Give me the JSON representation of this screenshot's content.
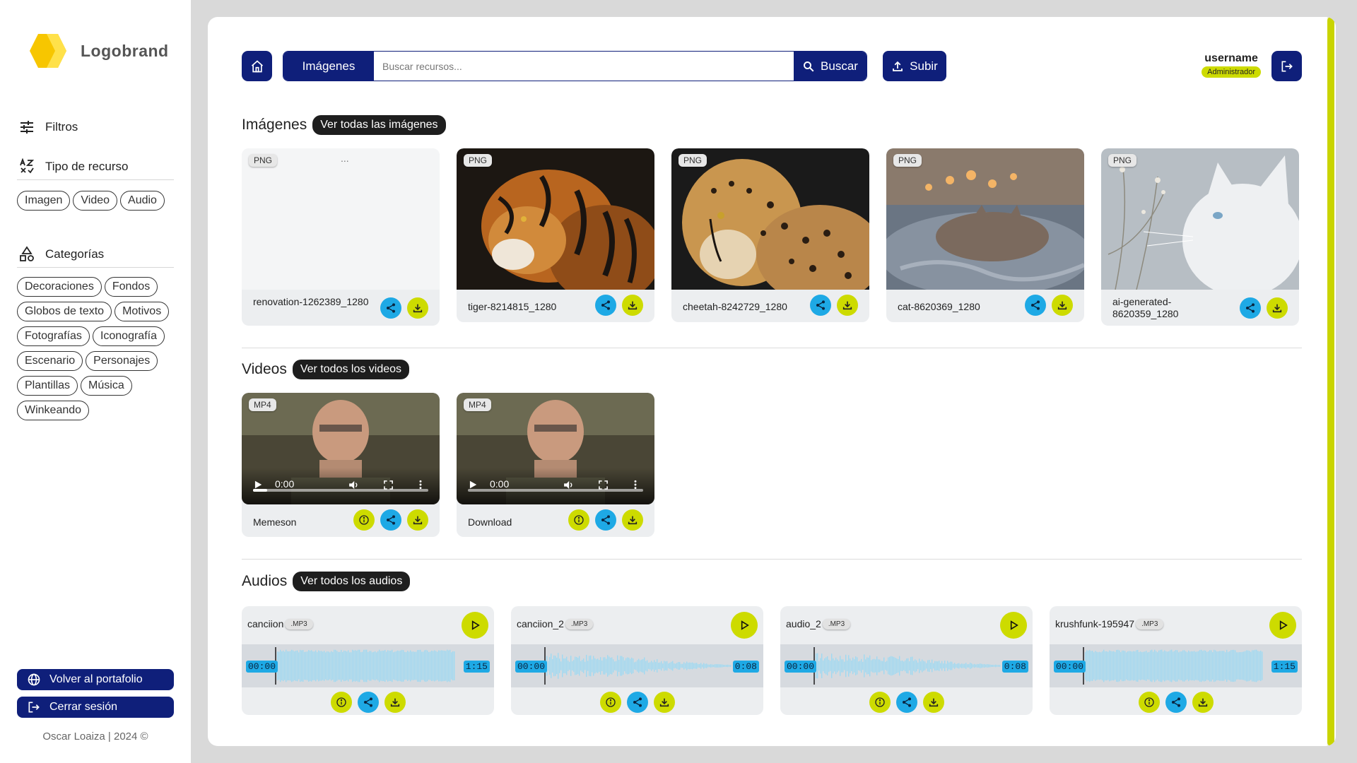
{
  "brand": {
    "name": "Logobrand"
  },
  "sidebar": {
    "filters_label": "Filtros",
    "resource_type": {
      "label": "Tipo de recurso",
      "chips": [
        "Imagen",
        "Video",
        "Audio"
      ]
    },
    "categories": {
      "label": "Categorías",
      "chips": [
        "Decoraciones",
        "Fondos",
        "Globos de texto",
        "Motivos",
        "Fotografías",
        "Iconografía",
        "Escenario",
        "Personajes",
        "Plantillas",
        "Música",
        "Winkeando"
      ]
    },
    "back_button": "Volver al portafolio",
    "logout_button": "Cerrar sesión",
    "footer": "Oscar Loaiza | 2024 ©"
  },
  "topbar": {
    "search_type": "Imágenes",
    "search_placeholder": "Buscar recursos...",
    "search_button": "Buscar",
    "upload_button": "Subir",
    "username": "username",
    "role": "Administrador"
  },
  "images": {
    "title": "Imágenes",
    "see_all": "Ver todas las imágenes",
    "items": [
      {
        "badge": "PNG",
        "name": "renovation-1262389_1280",
        "loading": true
      },
      {
        "badge": "PNG",
        "name": "tiger-8214815_1280"
      },
      {
        "badge": "PNG",
        "name": "cheetah-8242729_1280"
      },
      {
        "badge": "PNG",
        "name": "cat-8620369_1280"
      },
      {
        "badge": "PNG",
        "name": "ai-generated-8620359_1280"
      }
    ],
    "placeholder_dots": "..."
  },
  "videos": {
    "title": "Videos",
    "see_all": "Ver todos los videos",
    "items": [
      {
        "badge": "MP4",
        "name": "Memeson",
        "time": "0:00"
      },
      {
        "badge": "MP4",
        "name": "Download",
        "time": "0:00"
      }
    ]
  },
  "audios": {
    "title": "Audios",
    "see_all": "Ver todos los audios",
    "items": [
      {
        "name": "canciion",
        "ext": ".MP3",
        "start": "00:00",
        "end": "1:15"
      },
      {
        "name": "canciion_2",
        "ext": ".MP3",
        "start": "00:00",
        "end": "0:08"
      },
      {
        "name": "audio_2",
        "ext": ".MP3",
        "start": "00:00",
        "end": "0:08"
      },
      {
        "name": "krushfunk-195947",
        "ext": ".MP3",
        "start": "00:00",
        "end": "1:15"
      }
    ]
  },
  "colors": {
    "primary_navy": "#0f1f7a",
    "accent_lime": "#cddb00",
    "accent_blue": "#1ea9e5"
  }
}
